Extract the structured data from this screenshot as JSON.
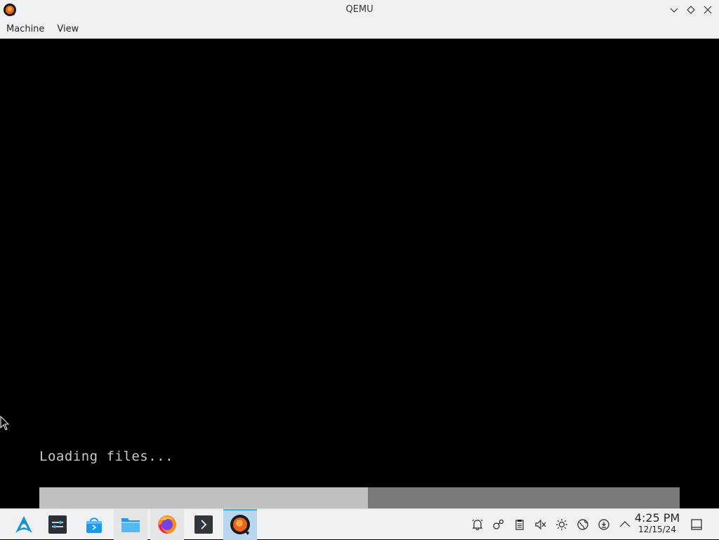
{
  "window": {
    "title": "QEMU",
    "app_icon": "qemu-icon",
    "controls": [
      "minimize-icon",
      "maximize-icon",
      "close-icon"
    ]
  },
  "menubar": {
    "items": [
      {
        "label": "Machine"
      },
      {
        "label": "View"
      }
    ]
  },
  "vm": {
    "loading_text": "Loading files...",
    "progress_fraction": 0.513
  },
  "taskbar": {
    "apps": [
      {
        "name": "application-launcher",
        "icon": "arch-logo-icon"
      },
      {
        "name": "system-settings",
        "icon": "settings-sliders-icon"
      },
      {
        "name": "discover-store",
        "icon": "store-bag-icon"
      },
      {
        "name": "file-manager",
        "icon": "folder-icon"
      },
      {
        "name": "firefox",
        "icon": "firefox-icon"
      },
      {
        "name": "terminal",
        "icon": "terminal-icon"
      },
      {
        "name": "qemu",
        "icon": "qemu-icon",
        "active": true
      }
    ],
    "tray": [
      "notifications-bell-icon",
      "kde-connect-icon",
      "clipboard-icon",
      "volume-muted-icon",
      "brightness-icon",
      "network-globe-icon",
      "updates-icon",
      "tray-expand-icon"
    ],
    "clock": {
      "time": "4:25 PM",
      "date": "12/15/24"
    },
    "accent_color": "#3daee9"
  }
}
